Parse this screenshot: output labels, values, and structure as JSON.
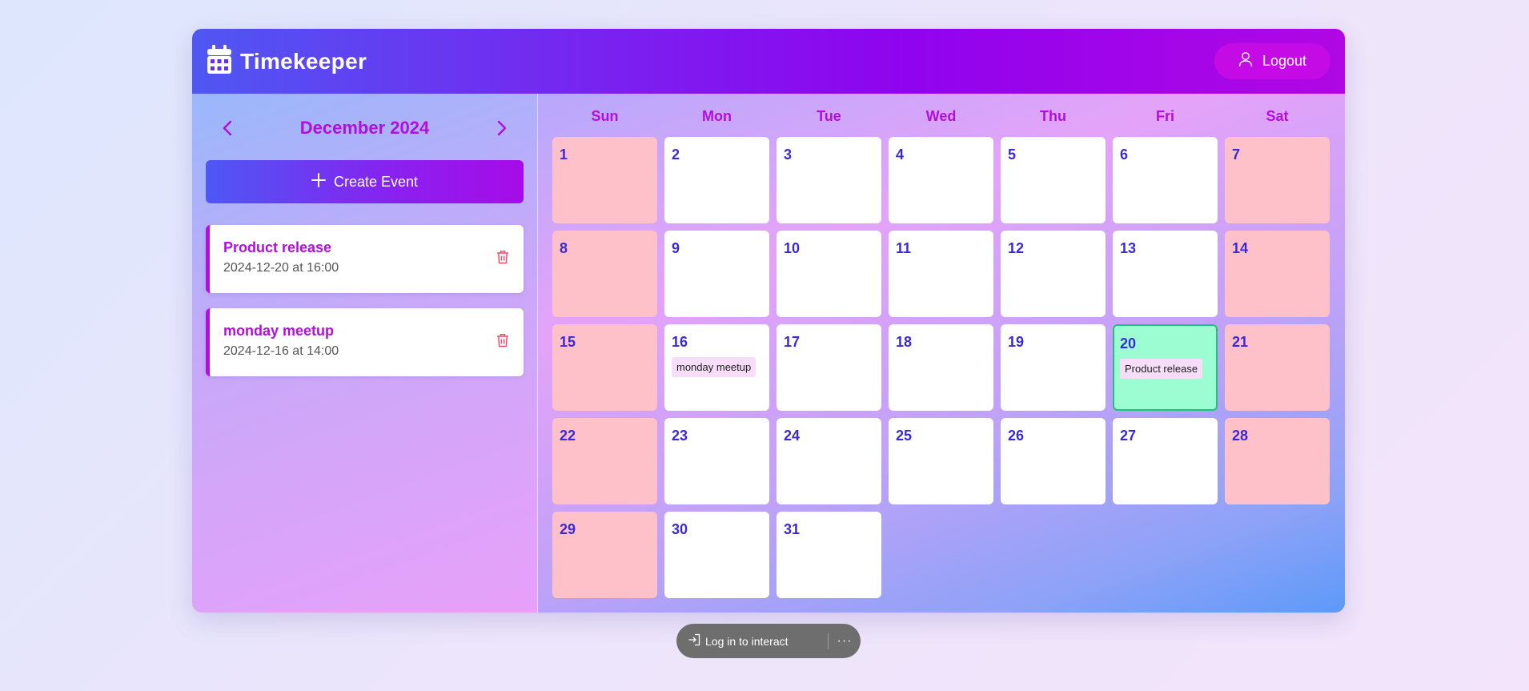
{
  "header": {
    "app_title": "Timekeeper",
    "logout_label": "Logout"
  },
  "sidebar": {
    "month_label": "December 2024",
    "create_label": "Create Event",
    "events": [
      {
        "title": "Product release",
        "when": "2024-12-20 at 16:00"
      },
      {
        "title": "monday meetup",
        "when": "2024-12-16 at 14:00"
      }
    ]
  },
  "calendar": {
    "weekdays": [
      "Sun",
      "Mon",
      "Tue",
      "Wed",
      "Thu",
      "Fri",
      "Sat"
    ],
    "days": [
      {
        "num": "1",
        "weekend": true
      },
      {
        "num": "2"
      },
      {
        "num": "3"
      },
      {
        "num": "4"
      },
      {
        "num": "5"
      },
      {
        "num": "6"
      },
      {
        "num": "7",
        "weekend": true
      },
      {
        "num": "8",
        "weekend": true
      },
      {
        "num": "9"
      },
      {
        "num": "10"
      },
      {
        "num": "11"
      },
      {
        "num": "12"
      },
      {
        "num": "13"
      },
      {
        "num": "14",
        "weekend": true
      },
      {
        "num": "15",
        "weekend": true
      },
      {
        "num": "16",
        "event": "monday meetup"
      },
      {
        "num": "17"
      },
      {
        "num": "18"
      },
      {
        "num": "19"
      },
      {
        "num": "20",
        "today": true,
        "event": "Product release"
      },
      {
        "num": "21",
        "weekend": true
      },
      {
        "num": "22",
        "weekend": true
      },
      {
        "num": "23"
      },
      {
        "num": "24"
      },
      {
        "num": "25"
      },
      {
        "num": "26"
      },
      {
        "num": "27"
      },
      {
        "num": "28",
        "weekend": true
      },
      {
        "num": "29",
        "weekend": true
      },
      {
        "num": "30"
      },
      {
        "num": "31"
      }
    ]
  },
  "toast": {
    "label": "Log in to interact",
    "more": "···"
  },
  "colors": {
    "accent": "#b10ee0",
    "day_number": "#3b2ad4",
    "weekend_cell": "#fec0c9",
    "today_cell": "#9cfcd2",
    "event_chip": "#f8ddfa"
  }
}
